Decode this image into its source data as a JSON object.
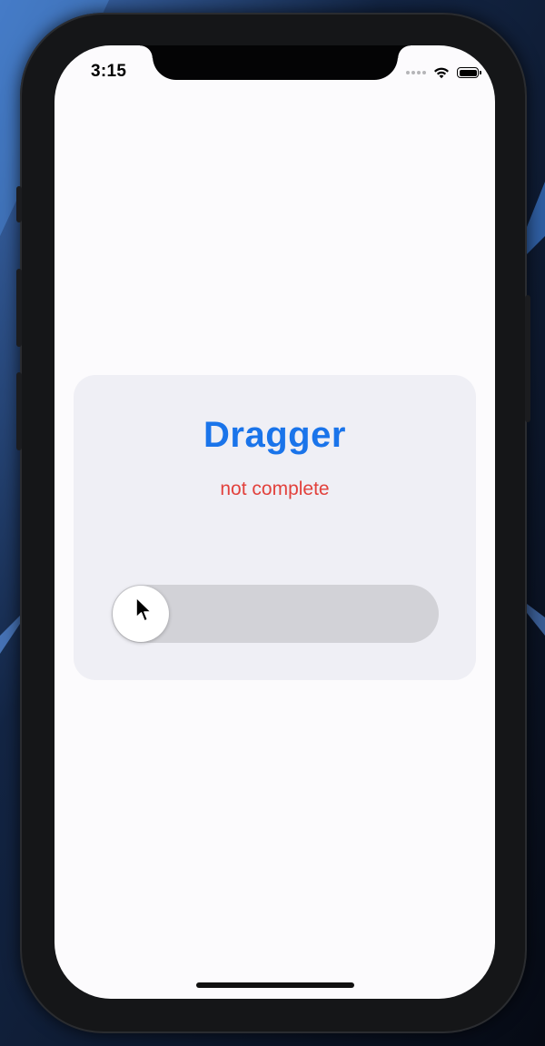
{
  "status_bar": {
    "time": "3:15"
  },
  "card": {
    "title": "Dragger",
    "status": "not complete"
  },
  "slider": {
    "progress": 0
  },
  "colors": {
    "title": "#1a74ea",
    "status": "#e2413c",
    "card_background": "#efeff5",
    "track": "#d2d2d7",
    "screen_background": "#fcfbfd"
  },
  "icons": {
    "wifi": "wifi-icon",
    "battery": "battery-icon",
    "cursor": "mouse-pointer-icon"
  }
}
